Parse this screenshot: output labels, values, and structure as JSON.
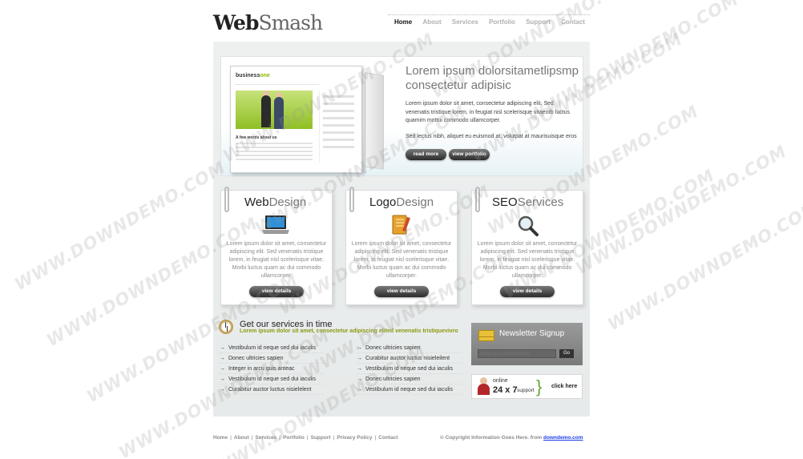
{
  "logo": {
    "part1": "Web",
    "part2": "Smash"
  },
  "nav": [
    "Home",
    "About",
    "Services",
    "Portfolio",
    "Support",
    "Contact"
  ],
  "hero": {
    "title": "Lorem ipsum dolorsitametlipsmp consectetur adipisic",
    "p1": "Lorem ipsum dolor sit amet, consectetur adipiscing elit. Sed venenatis tristique lorem, in feugiat nisl scelerisque vitaeorb luctus quamim mottui commodo ullamcorper.",
    "p2": "Sed lectus nibh, aliquet eu euismod at, volutpat at maurisuisque eros",
    "read_more": "read more",
    "view_portfolio": "view portfolio",
    "mock_logo_a": "business",
    "mock_logo_b": "one",
    "mock_heading": "A few words about us"
  },
  "services": [
    {
      "title_a": "Web",
      "title_b": "Design",
      "text": "Lorem ipsum dolor sit amet, consectetur adipiscing elit. Sed venenatis tristique lorem, in feugiat nisl scelerisque vitae. Morbi luctus quam ac dui commodo ullamcorper.",
      "button": "view details"
    },
    {
      "title_a": "Logo",
      "title_b": "Design",
      "text": "Lorem ipsum dolor sit amet, consectetur adipiscing elit. Sed venenatis tristique lorem, in feugiat nisl scelerisque vitae. Morbi luctus quam ac dui commodo ullamcorper.",
      "button": "view details"
    },
    {
      "title_a": "SEO",
      "title_b": "Services",
      "text": "Lorem ipsum dolor sit amet, consectetur adipiscing elit. Sed venenatis tristique lorem, in feugiat nisl scelerisque vitae. Morbi luctus quam ac dui commodo ullamcorper.",
      "button": "view details"
    }
  ],
  "services_time": {
    "title": "Get our services in time",
    "subtitle": "Lorem ipsum dolor sit amet, consectetur adipiscing elited venenatis tristiquevivro",
    "col1": [
      "Vestibulum id neque sed dui iaculis",
      "Donec ultricies sapien",
      "Integer in arcu quis anteac",
      "Vestibulum id neque sed dui iaculis",
      "Curabitur auctor luctus nisielelent"
    ],
    "col2": [
      "Donec ultricies sapien",
      "Curabitur auctor luctus nisieleilent",
      "Vestibulum id neque sed dui iaculis",
      "Donec ultricies sapien",
      "Vestibulum id neque sed dui iaculis"
    ]
  },
  "newsletter": {
    "title": "Newsletter Signup",
    "placeholder": "Enter your email address",
    "go": "Go"
  },
  "support": {
    "online": "online",
    "hours": "24 x 7",
    "label": "support",
    "click": "click here"
  },
  "footer": {
    "links": [
      "Home",
      "About",
      "Services",
      "Portfolio",
      "Support",
      "Privacy Policy",
      "Contact"
    ],
    "copyright": "© Copyright Information Goes Here. from ",
    "site": "downdemo.com"
  },
  "watermark": "WWW.DOWNDEMO.COM"
}
